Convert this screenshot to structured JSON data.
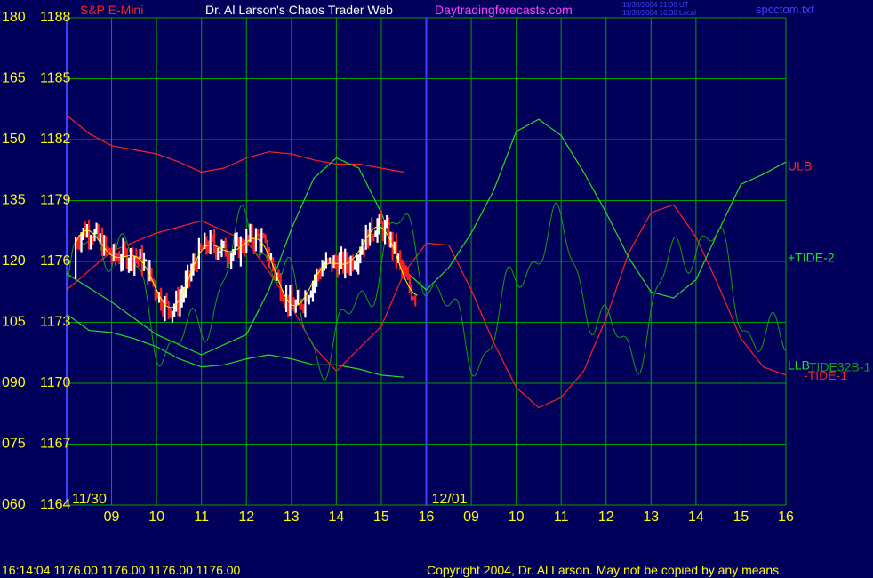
{
  "header": {
    "instrument": "S&P E-Mini",
    "title": "Dr. Al Larson's Chaos Trader Web",
    "site": "Daytradingforecasts.com",
    "time_utc": "11/30/2004 21:30 UT",
    "time_local": "11/30/2004 16:30 Local",
    "file": "spcctom.txt"
  },
  "footer": {
    "status": "16:14:04   1176.00 1176.00 1176.00 1176.00",
    "copyright": "Copyright 2004, Dr. Al Larson. May not be copied by any means."
  },
  "colors": {
    "background": "#00005a",
    "grid": "#00a000",
    "yellow": "#ffff00",
    "red": "#ff2020",
    "green": "#20e020",
    "magenta": "#ff40ff",
    "blue": "#4040ff",
    "white": "#ffffff"
  },
  "chart_data": {
    "type": "line",
    "y_axis_left": [
      "180",
      "165",
      "150",
      "135",
      "120",
      "105",
      "090",
      "075",
      "060"
    ],
    "y_axis_price": [
      "1188",
      "1185",
      "1182",
      "1179",
      "1176",
      "1173",
      "1170",
      "1167",
      "1164"
    ],
    "ylim_price": [
      1164,
      1188
    ],
    "ylim_index": [
      60,
      180
    ],
    "dates": [
      "11/30",
      "12/01"
    ],
    "x_ticks": [
      "09",
      "10",
      "11",
      "12",
      "13",
      "14",
      "15",
      "16",
      "09",
      "10",
      "11",
      "12",
      "13",
      "14",
      "15",
      "16"
    ],
    "x_range_hours": [
      0,
      16
    ],
    "series": [
      {
        "name": "ULB",
        "color": "#ff2020",
        "label_pos": "right",
        "x": [
          0,
          0.5,
          1,
          1.5,
          2,
          2.5,
          3,
          3.5,
          4,
          4.5,
          5,
          5.5,
          6,
          6.5,
          7,
          7.5
        ],
        "y": [
          1183.2,
          1182.3,
          1181.7,
          1181.5,
          1181.3,
          1180.9,
          1180.4,
          1180.6,
          1181.1,
          1181.4,
          1181.3,
          1181.0,
          1180.8,
          1180.8,
          1180.6,
          1180.4
        ]
      },
      {
        "name": "LLB",
        "color": "#20e020",
        "label_pos": "right",
        "x": [
          0,
          0.5,
          1,
          1.5,
          2,
          2.5,
          3,
          3.5,
          4,
          4.5,
          5,
          5.5,
          6,
          6.5,
          7,
          7.5
        ],
        "y": [
          1173.4,
          1172.6,
          1172.5,
          1172.2,
          1171.8,
          1171.2,
          1170.8,
          1170.9,
          1171.2,
          1171.4,
          1171.2,
          1170.9,
          1170.9,
          1170.7,
          1170.4,
          1170.3
        ]
      },
      {
        "name": "-TIDE-1",
        "color": "#ff2020",
        "label_pos": "right",
        "x": [
          0,
          1,
          2,
          3,
          4,
          4.5,
          5,
          5.5,
          6,
          7,
          7.5,
          8,
          8.5,
          9,
          9.5,
          10,
          10.5,
          11,
          11.5,
          12,
          12.5,
          13,
          13.5,
          14,
          14.5,
          15,
          15.5,
          16
        ],
        "y": [
          1174.6,
          1176.5,
          1177.4,
          1178.0,
          1177.0,
          1175.5,
          1173.8,
          1171.8,
          1170.6,
          1172.8,
          1175.4,
          1176.9,
          1176.8,
          1174.6,
          1172.0,
          1169.8,
          1168.8,
          1169.3,
          1170.6,
          1173.2,
          1176.4,
          1178.4,
          1178.8,
          1177.2,
          1174.8,
          1172.2,
          1170.8,
          1170.4
        ]
      },
      {
        "name": "+TIDE-2",
        "color": "#20e020",
        "label_pos": "right",
        "x": [
          0,
          1,
          2,
          3,
          4,
          4.5,
          5,
          5.5,
          6,
          6.5,
          7,
          7.5,
          8,
          8.5,
          9,
          9.5,
          10,
          10.5,
          11,
          11.5,
          12,
          12.5,
          13,
          13.5,
          14,
          14.5,
          15,
          15.5,
          16
        ],
        "y": [
          1175.4,
          1174.0,
          1172.4,
          1171.4,
          1172.4,
          1174.6,
          1177.6,
          1180.1,
          1181.1,
          1180.6,
          1178.4,
          1175.6,
          1174.6,
          1175.7,
          1177.4,
          1179.5,
          1182.4,
          1183.0,
          1182.2,
          1180.4,
          1178.4,
          1176.2,
          1174.5,
          1174.2,
          1175.1,
          1177.5,
          1179.8,
          1180.3,
          1180.9
        ]
      }
    ],
    "price_bars_note": "S&P E-Mini intraday price bars 11/30 09:00-16:00, range approx 1173.5-1178.7",
    "labels_right": [
      "ULB",
      "+TIDE-2",
      "LLB",
      "TIDE32B-1",
      "-TIDE-1"
    ]
  }
}
